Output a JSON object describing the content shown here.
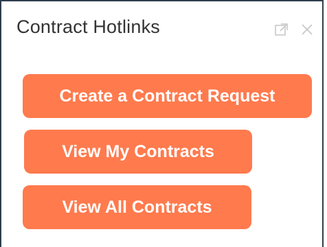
{
  "widget": {
    "title": "Contract Hotlinks",
    "icons": [
      "popout-icon",
      "close-icon"
    ],
    "accent_color": "#ff7a4d",
    "border_color": "#2f3e4e"
  },
  "buttons": [
    {
      "label": "Create a Contract Request"
    },
    {
      "label": "View My Contracts"
    },
    {
      "label": "View All Contracts"
    }
  ]
}
